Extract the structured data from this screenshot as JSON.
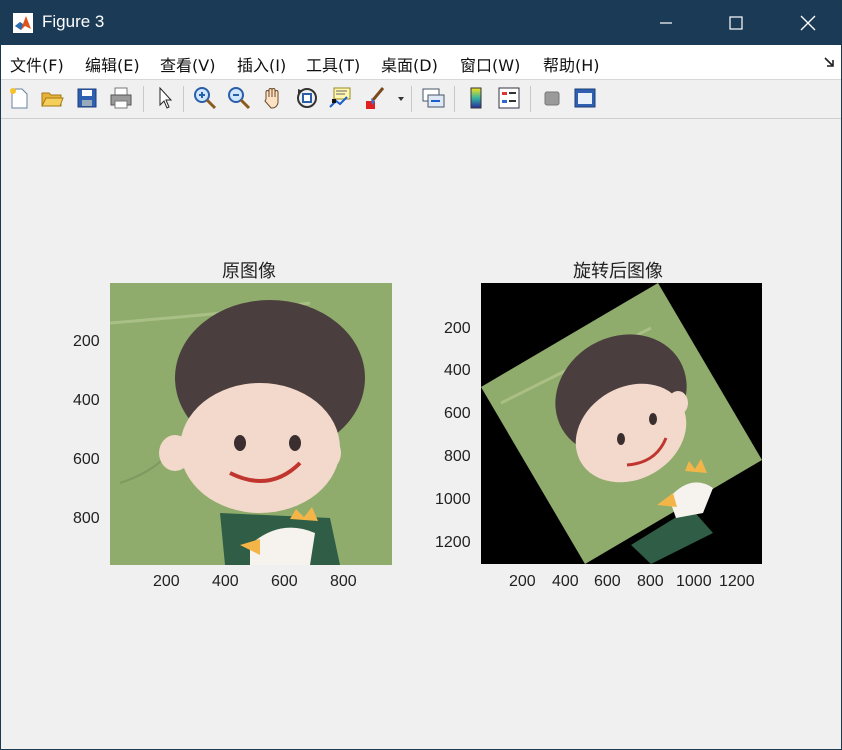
{
  "window": {
    "title": "Figure 3"
  },
  "menu": [
    "文件(F)",
    "编辑(E)",
    "查看(V)",
    "插入(I)",
    "工具(T)",
    "桌面(D)",
    "窗口(W)",
    "帮助(H)"
  ],
  "toolbar": {
    "buttons": [
      "new-figure",
      "open-file",
      "save",
      "print",
      "edit-plot",
      "zoom-in",
      "zoom-out",
      "pan",
      "rotate-3d",
      "data-cursor",
      "brush",
      "link-plot",
      "insert-colorbar",
      "insert-legend",
      "hide-plot-tools",
      "show-plot-tools"
    ]
  },
  "axes": [
    {
      "title": "原图像",
      "xticks": [
        "200",
        "400",
        "600",
        "800"
      ],
      "yticks": [
        "200",
        "400",
        "600",
        "800"
      ],
      "image": "original cartoon boy portrait on green background"
    },
    {
      "title": "旋转后图像",
      "xticks": [
        "200",
        "400",
        "600",
        "800",
        "1000",
        "1200"
      ],
      "yticks": [
        "200",
        "400",
        "600",
        "800",
        "1000",
        "1200"
      ],
      "image": "rotated cartoon boy portrait on black background"
    }
  ]
}
